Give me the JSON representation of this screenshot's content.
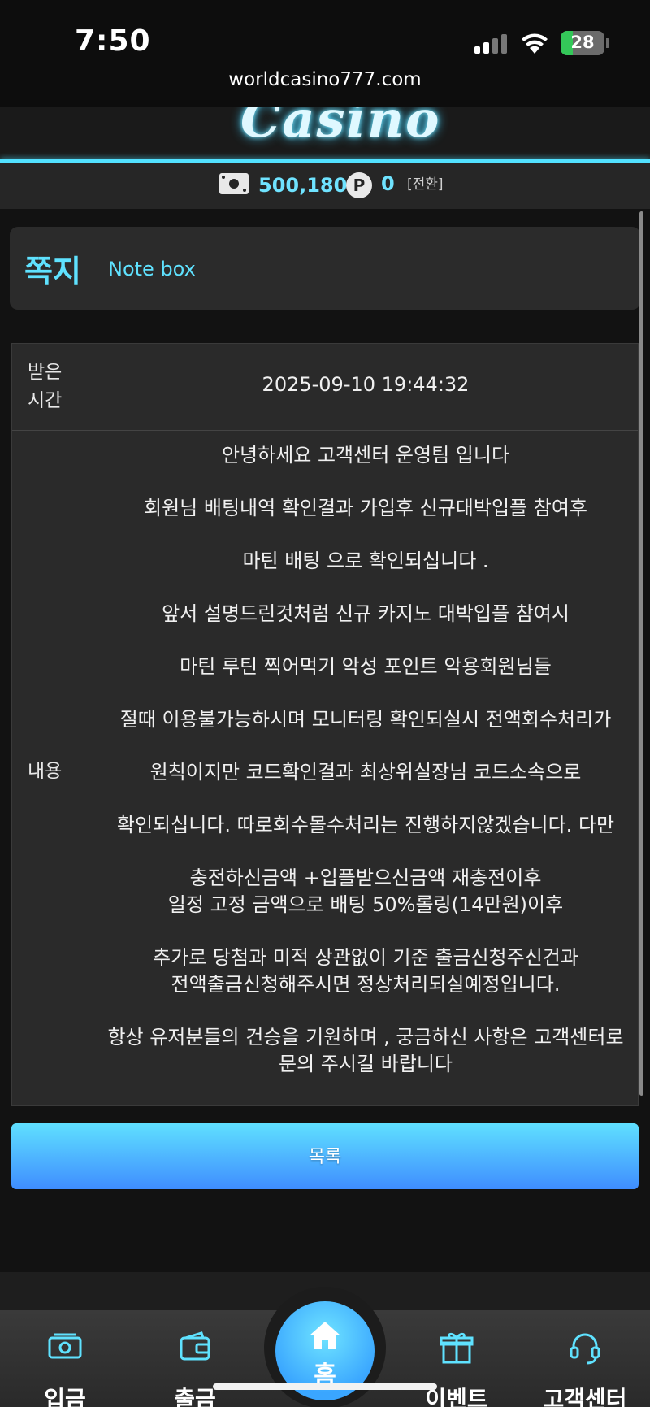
{
  "status": {
    "time": "7:50",
    "battery": "28",
    "battery_level": 0.28,
    "url": "worldcasino777.com"
  },
  "header": {
    "logo_text": "Casino"
  },
  "balance": {
    "money": "500,180",
    "point_badge": "P",
    "points": "0",
    "convert_label": "[전환]"
  },
  "note": {
    "title": "쪽지",
    "subtitle": "Note box"
  },
  "message": {
    "time_label": "받은\n시간",
    "time_value": "2025-09-10 19:44:32",
    "content_label": "내용",
    "lines": [
      "안녕하세요 고객센터 운영팀 입니다",
      "회원님 배팅내역 확인결과 가입후 신규대박입플 참여후",
      "마틴 배팅 으로 확인되십니다 .",
      "앞서 설명드린것처럼 신규 카지노 대박입플 참여시",
      "마틴 루틴 찍어먹기 악성 포인트 악용회원님들",
      "절때 이용불가능하시며 모니터링 확인되실시 전액회수처리가",
      "원칙이지만 코드확인결과 최상위실장님 코드소속으로",
      "확인되십니다. 따로회수몰수처리는 진행하지않겠습니다. 다만",
      "충전하신금액 +입플받으신금액 재충전이후\n일정 고정 금액으로 배팅 50%롤링(14만원)이후",
      "추가로 당첨과 미적 상관없이 기준 출금신청주신건과\n전액출금신청해주시면 정상처리되실예정입니다.",
      "항상 유저분들의 건승을 기원하며 , 궁금하신 사항은 고객센터로\n문의 주시길 바랍니다"
    ]
  },
  "list_button": "목록",
  "nav": {
    "deposit": "입금",
    "withdraw": "출금",
    "home": "홈",
    "event": "이벤트",
    "support": "고객센터"
  },
  "colors": {
    "accent": "#5fe2ff",
    "button_top": "#5fe0ff",
    "button_bottom": "#3f8dff"
  }
}
